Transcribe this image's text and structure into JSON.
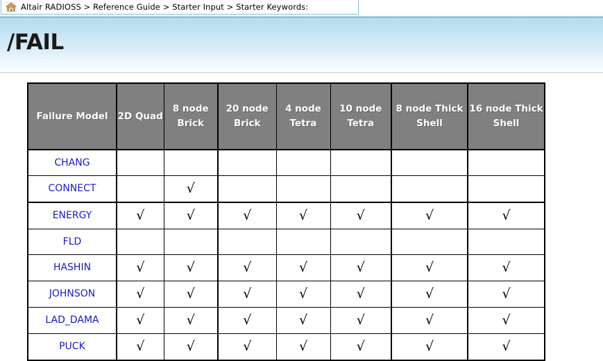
{
  "breadcrumb": {
    "home_icon": "home-icon",
    "text": "Altair RADIOSS > Reference Guide > Starter Input > Starter Keywords:",
    "segments": [
      "Altair RADIOSS",
      "Reference Guide",
      "Starter Input",
      "Starter Keywords:"
    ],
    "separator": ">"
  },
  "header": {
    "title": "/FAIL"
  },
  "colors": {
    "banner_gradient_top": "#b4dbef",
    "banner_gradient_bottom": "#fdfeff",
    "banner_border_top": "#3a8fae",
    "table_header_bg": "#808080",
    "table_header_text": "#ffffff",
    "link_blue": "#1a1ac0",
    "breadcrumb_border": "#7ec0e0",
    "cell_bg": "#ffffff",
    "border": "#000000"
  },
  "table": {
    "name": "failure-model-element-support-table",
    "columns": [
      {
        "key": "model",
        "label": "Failure Model"
      },
      {
        "key": "quad2d",
        "label": "2D Quad"
      },
      {
        "key": "b8",
        "label": "8 node Brick"
      },
      {
        "key": "b20",
        "label": "20 node Brick"
      },
      {
        "key": "t4",
        "label": "4 node Tetra"
      },
      {
        "key": "t10",
        "label": "10 node Tetra"
      },
      {
        "key": "ts8",
        "label": "8 node Thick Shell"
      },
      {
        "key": "ts16",
        "label": "16 node Thick Shell"
      }
    ],
    "check_glyph": "√",
    "rows": [
      {
        "model": "CHANG",
        "quad2d": "",
        "b8": "",
        "b20": "",
        "t4": "",
        "t10": "",
        "ts8": "",
        "ts16": ""
      },
      {
        "model": "CONNECT",
        "quad2d": "",
        "b8": "√",
        "b20": "",
        "t4": "",
        "t10": "",
        "ts8": "",
        "ts16": ""
      },
      {
        "model": "ENERGY",
        "quad2d": "√",
        "b8": "√",
        "b20": "√",
        "t4": "√",
        "t10": "√",
        "ts8": "√",
        "ts16": "√"
      },
      {
        "model": "FLD",
        "quad2d": "",
        "b8": "",
        "b20": "",
        "t4": "",
        "t10": "",
        "ts8": "",
        "ts16": ""
      },
      {
        "model": "HASHIN",
        "quad2d": "√",
        "b8": "√",
        "b20": "√",
        "t4": "√",
        "t10": "√",
        "ts8": "√",
        "ts16": "√"
      },
      {
        "model": "JOHNSON",
        "quad2d": "√",
        "b8": "√",
        "b20": "√",
        "t4": "√",
        "t10": "√",
        "ts8": "√",
        "ts16": "√"
      },
      {
        "model": "LAD_DAMA",
        "quad2d": "√",
        "b8": "√",
        "b20": "√",
        "t4": "√",
        "t10": "√",
        "ts8": "√",
        "ts16": "√"
      },
      {
        "model": "PUCK",
        "quad2d": "√",
        "b8": "√",
        "b20": "√",
        "t4": "√",
        "t10": "√",
        "ts8": "√",
        "ts16": "√"
      }
    ]
  }
}
